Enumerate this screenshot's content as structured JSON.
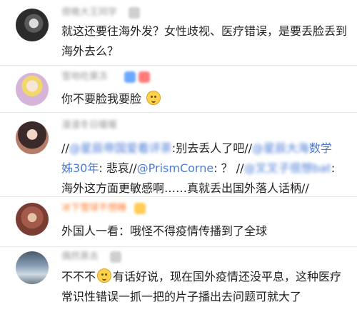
{
  "comments": [
    {
      "username": "",
      "text": "就这还要往海外发？女性歧视、医疗错误，是要丢脸丢到海外去么？"
    },
    {
      "username": "",
      "text_before": "你不要脸我要脸"
    },
    {
      "username": "",
      "line1_a": "//",
      "line1_b": ":别去丢人了吧//",
      "line2_a": "姊30年",
      "line2_b": ": 悲哀//",
      "line2_c": "@PrismCorne",
      "line2_d": ": ？ //",
      "line3": "海外这方面更敏感啊……真就丢出国外落人话柄//"
    },
    {
      "username": "",
      "text": "外国人一看：哦怪不得疫情传播到了全球"
    },
    {
      "username": "",
      "text_a": "不不不",
      "text_b": "有话好说，现在国外疫情还没平息，这种医疗常识性错误一抓一把的片子播出去问题可就大了"
    }
  ],
  "colors": {
    "mention": "#4a7bd6",
    "username_gray": "#9a9a9a",
    "username_orange": "#ff7a2a",
    "divider": "#e6e6e6"
  }
}
